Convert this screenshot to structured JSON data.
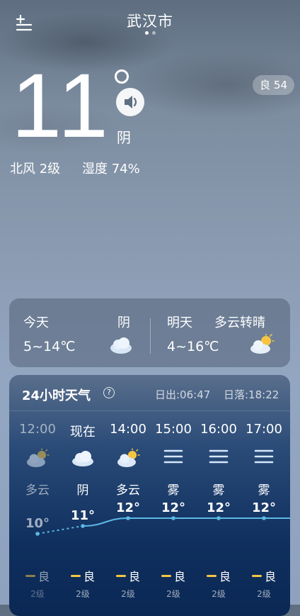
{
  "location": {
    "city": "武汉市"
  },
  "current": {
    "temperature": "11",
    "condition": "阴",
    "wind": "北风 2级",
    "humidity": "湿度 74%",
    "aqi": "良 54"
  },
  "daily": [
    {
      "day": "今天",
      "condition": "阴",
      "range": "5~14℃",
      "icon": "cloud-icon"
    },
    {
      "day": "明天",
      "condition": "多云转晴",
      "range": "4~16℃",
      "icon": "partly-sunny-icon"
    }
  ],
  "hourly": {
    "title": "24小时天气",
    "sunrise": "日出:06:47",
    "sunset": "日落:18:22",
    "items": [
      {
        "time": "12:00",
        "condition": "多云",
        "temp": "10°",
        "temp_value": 10,
        "aqi": "良",
        "wind": "2级",
        "icon": "partly-cloudy-icon",
        "past": true
      },
      {
        "time": "现在",
        "condition": "阴",
        "temp": "11°",
        "temp_value": 11,
        "aqi": "良",
        "wind": "2级",
        "icon": "cloud-icon",
        "past": false
      },
      {
        "time": "14:00",
        "condition": "多云",
        "temp": "12°",
        "temp_value": 12,
        "aqi": "良",
        "wind": "2级",
        "icon": "partly-cloudy-icon",
        "past": false
      },
      {
        "time": "15:00",
        "condition": "雾",
        "temp": "12°",
        "temp_value": 12,
        "aqi": "良",
        "wind": "2级",
        "icon": "fog-icon",
        "past": false
      },
      {
        "time": "16:00",
        "condition": "雾",
        "temp": "12°",
        "temp_value": 12,
        "aqi": "良",
        "wind": "2级",
        "icon": "fog-icon",
        "past": false
      },
      {
        "time": "17:00",
        "condition": "雾",
        "temp": "12°",
        "temp_value": 12,
        "aqi": "良",
        "wind": "2级",
        "icon": "fog-icon",
        "past": false
      }
    ]
  },
  "colors": {
    "aqi_good": "#f5c542",
    "temp_line": "#5bb8e6"
  }
}
